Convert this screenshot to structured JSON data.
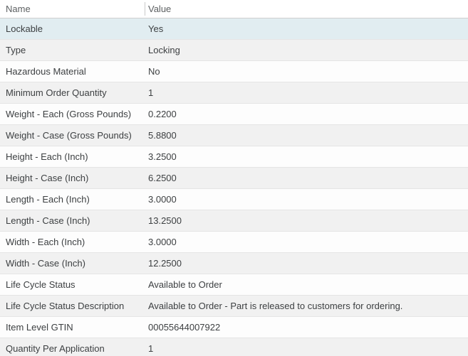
{
  "table": {
    "columns": [
      {
        "label": "Name"
      },
      {
        "label": "Value"
      }
    ],
    "rows": [
      {
        "name": "Lockable",
        "value": "Yes",
        "highlighted": true
      },
      {
        "name": "Type",
        "value": "Locking",
        "highlighted": false
      },
      {
        "name": "Hazardous Material",
        "value": "No",
        "highlighted": false
      },
      {
        "name": "Minimum Order Quantity",
        "value": "1",
        "highlighted": false
      },
      {
        "name": "Weight - Each (Gross Pounds)",
        "value": "0.2200",
        "highlighted": false
      },
      {
        "name": "Weight - Case (Gross Pounds)",
        "value": "5.8800",
        "highlighted": false
      },
      {
        "name": "Height - Each (Inch)",
        "value": "3.2500",
        "highlighted": false
      },
      {
        "name": "Height - Case (Inch)",
        "value": "6.2500",
        "highlighted": false
      },
      {
        "name": "Length - Each (Inch)",
        "value": "3.0000",
        "highlighted": false
      },
      {
        "name": "Length - Case (Inch)",
        "value": "13.2500",
        "highlighted": false
      },
      {
        "name": "Width - Each (Inch)",
        "value": "3.0000",
        "highlighted": false
      },
      {
        "name": "Width - Case (Inch)",
        "value": "12.2500",
        "highlighted": false
      },
      {
        "name": "Life Cycle Status",
        "value": "Available to Order",
        "highlighted": false
      },
      {
        "name": "Life Cycle Status Description",
        "value": "Available to Order - Part is released to customers for ordering.",
        "highlighted": false
      },
      {
        "name": "Item Level GTIN",
        "value": "00055644007922",
        "highlighted": false
      },
      {
        "name": "Quantity Per Application",
        "value": "1",
        "highlighted": false
      }
    ],
    "colors": {
      "highlight_row": "#e1edf1",
      "stripe_row": "#f1f1f1",
      "plain_row": "#fdfdfd",
      "row_border": "#e5e5e5",
      "header_text": "#5d6062",
      "body_text": "#3c3f41",
      "column_divider": "#c9c9c9"
    }
  }
}
